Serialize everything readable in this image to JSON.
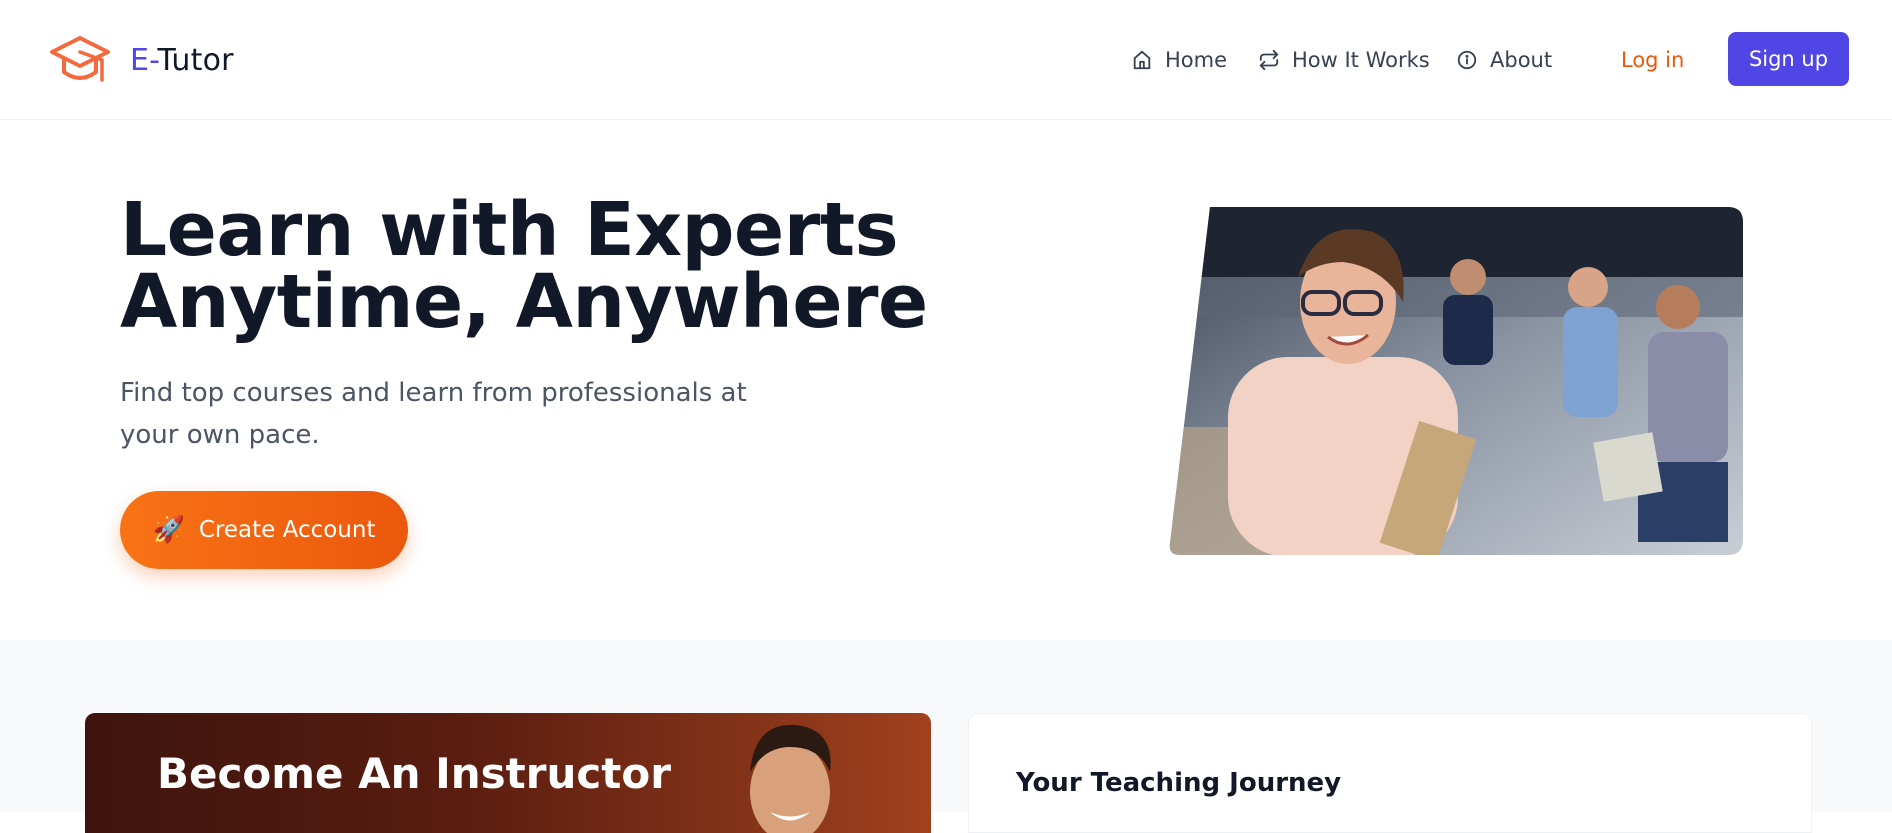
{
  "brand": {
    "prefix": "E-",
    "name": "Tutor"
  },
  "nav": {
    "home": "Home",
    "how_it_works": "How It Works",
    "about": "About"
  },
  "auth": {
    "login": "Log in",
    "signup": "Sign up"
  },
  "hero": {
    "title_line1": "Learn with Experts",
    "title_line2": "Anytime, Anywhere",
    "subtitle": "Find top courses and learn from professionals at your own pace.",
    "cta_icon": "🚀",
    "cta_label": "Create Account"
  },
  "instructor": {
    "title": "Become An Instructor"
  },
  "journey": {
    "title": "Your Teaching Journey"
  },
  "colors": {
    "primary": "#4f46e5",
    "accent": "#ea580c",
    "heading": "#111827"
  },
  "icons": {
    "logo": "graduation-cap-icon",
    "home": "home-icon",
    "how_it_works": "repeat-icon",
    "about": "info-icon",
    "cta": "rocket-icon"
  }
}
